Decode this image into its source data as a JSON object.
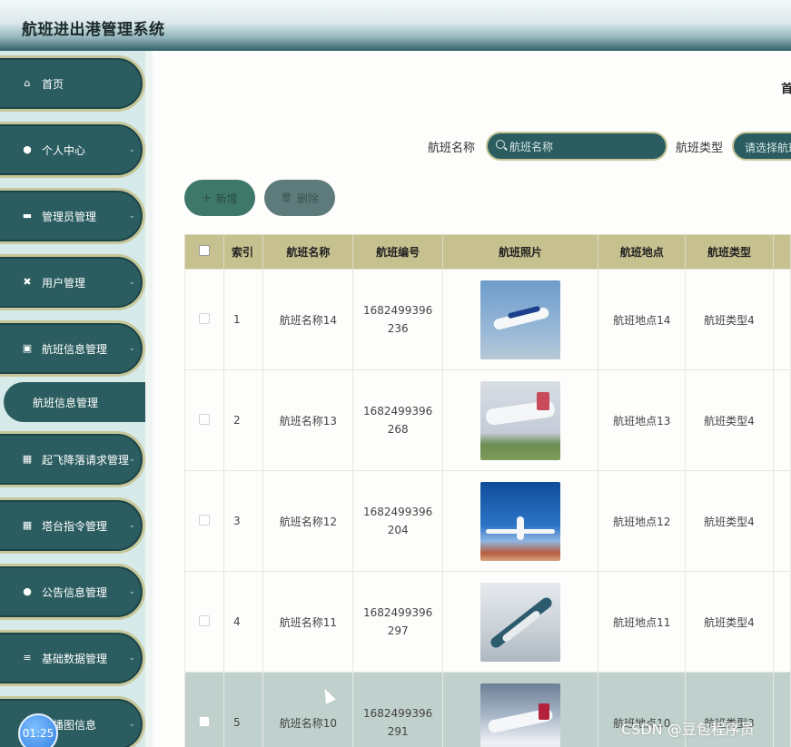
{
  "app": {
    "title": "航班进出港管理系统"
  },
  "breadcrumb": {
    "home": "首"
  },
  "sidebar": {
    "items": [
      {
        "label": "首页",
        "icon": "home-icon",
        "glyph": "⌂"
      },
      {
        "label": "个人中心",
        "icon": "person-icon",
        "glyph": "●"
      },
      {
        "label": "管理员管理",
        "icon": "admin-icon",
        "glyph": "▬"
      },
      {
        "label": "用户管理",
        "icon": "users-icon",
        "glyph": "✖"
      },
      {
        "label": "航班信息管理",
        "icon": "clipboard-icon",
        "glyph": "▣"
      },
      {
        "label": "起飞降落请求管理",
        "icon": "grid-icon",
        "glyph": "▦"
      },
      {
        "label": "塔台指令管理",
        "icon": "grid-icon",
        "glyph": "▦"
      },
      {
        "label": "公告信息管理",
        "icon": "pin-icon",
        "glyph": "●"
      },
      {
        "label": "基础数据管理",
        "icon": "list-icon",
        "glyph": "≡"
      },
      {
        "label": "轮播图信息",
        "icon": "image-icon",
        "glyph": "▣"
      }
    ],
    "sub_item": "航班信息管理",
    "chevron": "⌄"
  },
  "search": {
    "name_label": "航班名称",
    "name_placeholder": "航班名称",
    "type_label": "航班类型",
    "type_placeholder": "请选择航班类型"
  },
  "toolbar": {
    "add_label": "新增",
    "delete_label": "删除",
    "add_glyph": "+",
    "delete_glyph": "🗑"
  },
  "table": {
    "headers": [
      "",
      "索引",
      "航班名称",
      "航班编号",
      "航班照片",
      "航班地点",
      "航班类型"
    ],
    "rows": [
      {
        "index": "1",
        "name": "航班名称14",
        "number": "1682499396236",
        "place": "航班地点14",
        "type": "航班类型4"
      },
      {
        "index": "2",
        "name": "航班名称13",
        "number": "1682499396268",
        "place": "航班地点13",
        "type": "航班类型4"
      },
      {
        "index": "3",
        "name": "航班名称12",
        "number": "1682499396204",
        "place": "航班地点12",
        "type": "航班类型4"
      },
      {
        "index": "4",
        "name": "航班名称11",
        "number": "1682499396297",
        "place": "航班地点11",
        "type": "航班类型4"
      },
      {
        "index": "5",
        "name": "航班名称10",
        "number": "1682499396291",
        "place": "航班地点10",
        "type": "航班类型3"
      }
    ]
  },
  "overlay": {
    "timer": "01:25",
    "watermark": "CSDN @豆包程序员"
  }
}
